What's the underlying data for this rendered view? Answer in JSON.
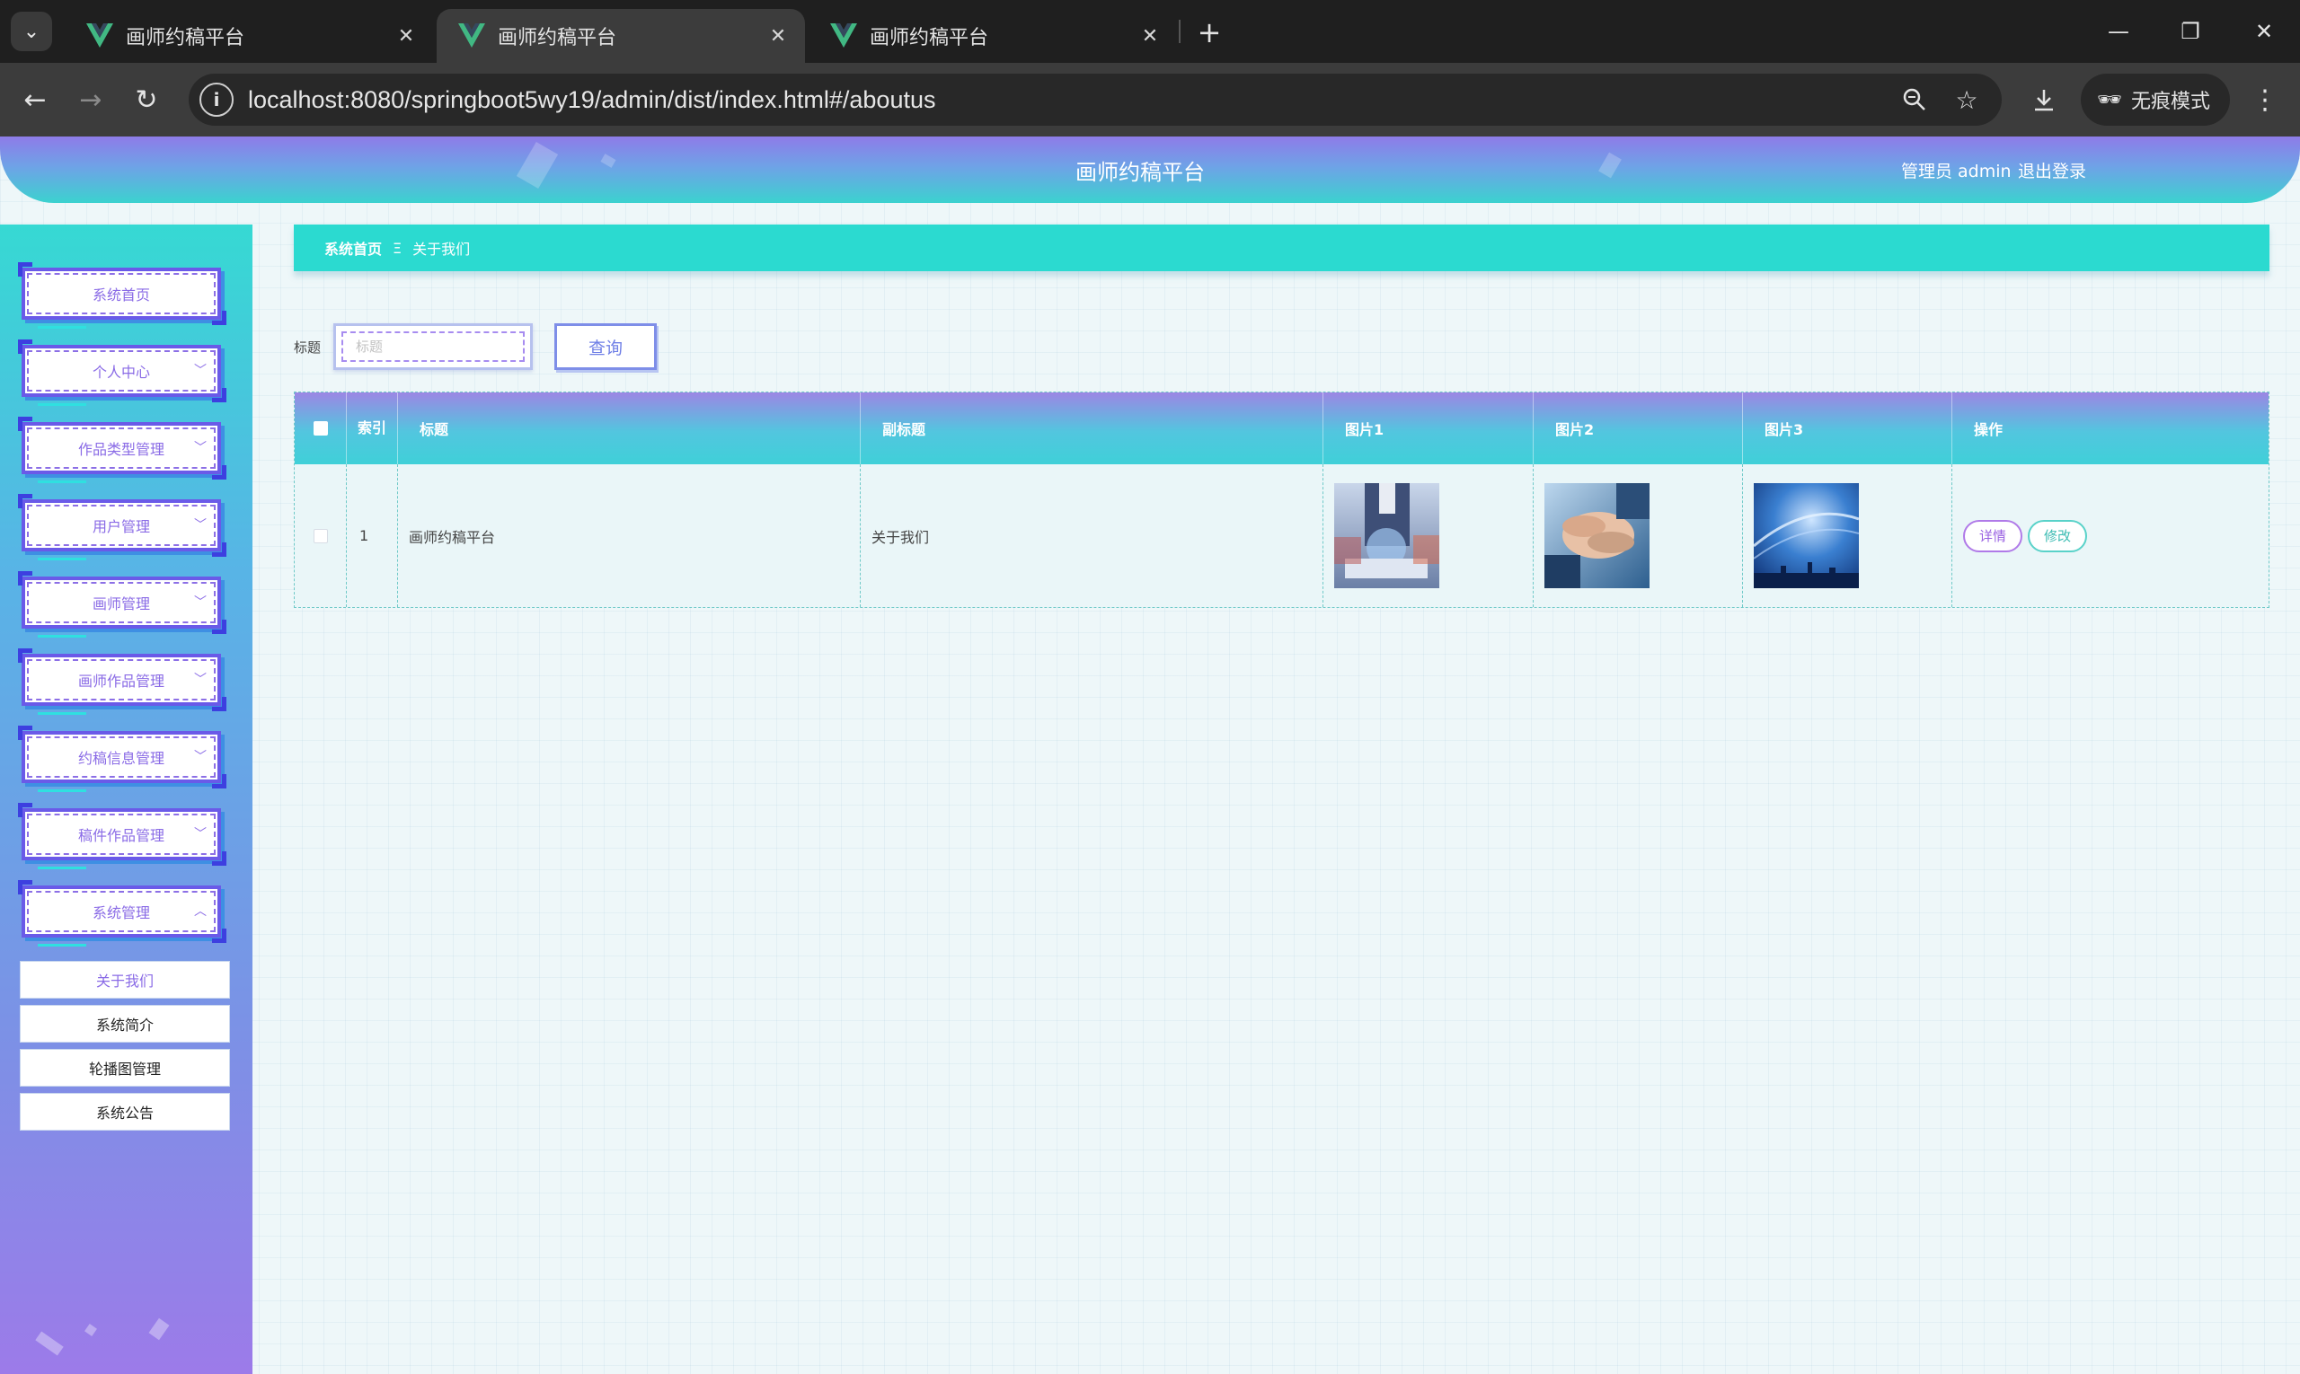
{
  "browser": {
    "tabs": [
      {
        "title": "画师约稿平台",
        "active": false
      },
      {
        "title": "画师约稿平台",
        "active": true
      },
      {
        "title": "画师约稿平台",
        "active": false
      }
    ],
    "url": "localhost:8080/springboot5wy19/admin/dist/index.html#/aboutus",
    "incognito_label": "无痕模式"
  },
  "header": {
    "title": "画师约稿平台",
    "user": "管理员 admin",
    "logout": "退出登录"
  },
  "sidebar": {
    "items": [
      {
        "label": "系统首页",
        "has_arrow": false
      },
      {
        "label": "个人中心",
        "has_arrow": true
      },
      {
        "label": "作品类型管理",
        "has_arrow": true
      },
      {
        "label": "用户管理",
        "has_arrow": true
      },
      {
        "label": "画师管理",
        "has_arrow": true
      },
      {
        "label": "画师作品管理",
        "has_arrow": true
      },
      {
        "label": "约稿信息管理",
        "has_arrow": true
      },
      {
        "label": "稿件作品管理",
        "has_arrow": true
      },
      {
        "label": "系统管理",
        "has_arrow": true,
        "expanded": true
      }
    ],
    "submenu": [
      {
        "label": "关于我们",
        "active": true
      },
      {
        "label": "系统简介",
        "active": false
      },
      {
        "label": "轮播图管理",
        "active": false
      },
      {
        "label": "系统公告",
        "active": false
      }
    ]
  },
  "breadcrumb": {
    "home": "系统首页",
    "separator": "Ξ",
    "current": "关于我们"
  },
  "search": {
    "label": "标题",
    "placeholder": "标题",
    "button": "查询"
  },
  "table": {
    "headers": [
      "索引",
      "标题",
      "副标题",
      "图片1",
      "图片2",
      "图片3",
      "操作"
    ],
    "rows": [
      {
        "index": "1",
        "title": "画师约稿平台",
        "subtitle": "关于我们",
        "actions": [
          "详情",
          "修改"
        ]
      }
    ]
  },
  "colors": {
    "accent_purple": "#8a6be6",
    "accent_teal": "#2bdad0",
    "header_gradient_top": "#8e7be8",
    "header_gradient_bottom": "#3bd2cf"
  }
}
